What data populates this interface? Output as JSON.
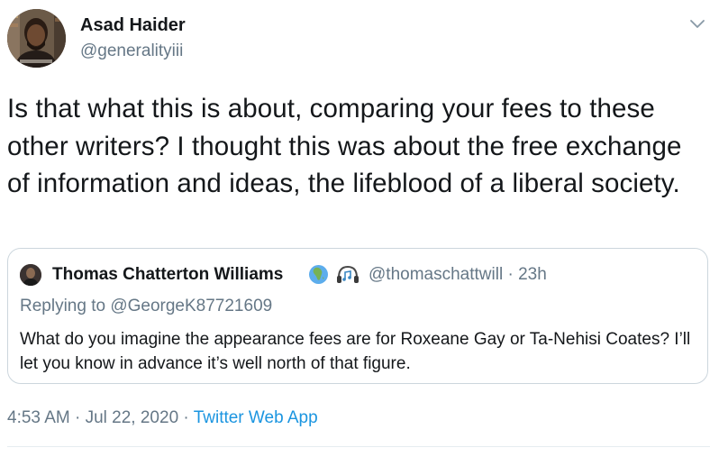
{
  "tweet": {
    "author": {
      "name": "Asad Haider",
      "handle": "@generalityiii"
    },
    "text": "Is that what this is about, comparing your fees to these other writers? I thought this was about the free exchange of information and ideas, the lifeblood of a liberal society.",
    "time": "4:53 AM",
    "separator": " · ",
    "date": "Jul 22, 2020",
    "source": "Twitter Web App"
  },
  "quoted": {
    "author": {
      "name": "Thomas Chatterton Williams",
      "handle": "@thomaschattwill",
      "age": "23h"
    },
    "replying_to": "Replying to @GeorgeK87721609",
    "text": "What do you imagine the appearance fees are for Roxeane Gay or Ta-Nehisi Coates? I’ll let you know in advance it’s well north of that figure.",
    "badges": [
      "globe-africa-icon",
      "headphones-music-icon"
    ]
  },
  "colors": {
    "text": "#14171a",
    "secondary": "#657786",
    "link": "#1b95e0",
    "border": "#ccd6dd"
  }
}
